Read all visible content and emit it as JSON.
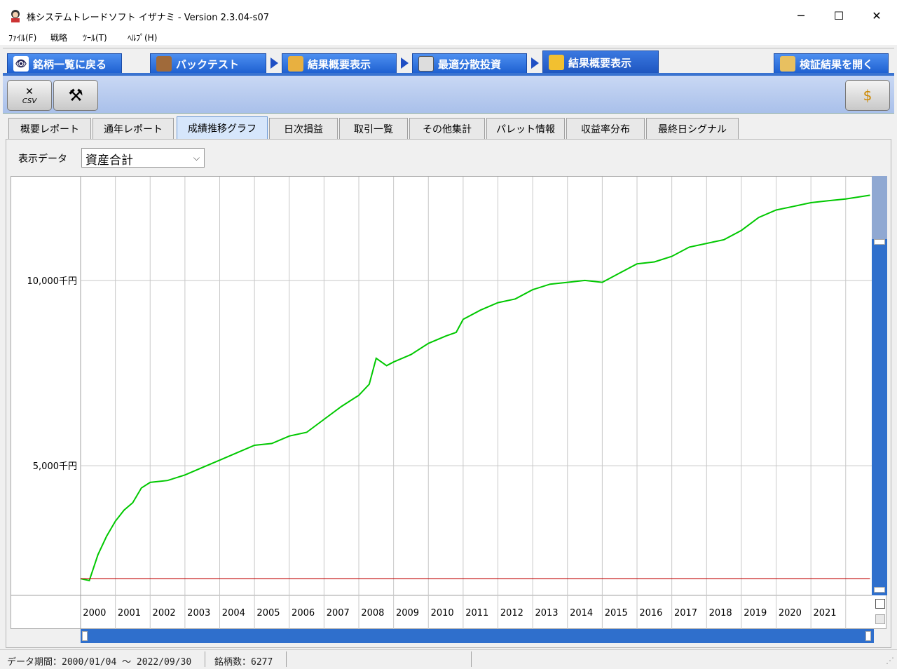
{
  "window": {
    "title": "株システムトレードソフト イザナミ - Version 2.3.04-s07",
    "minimize_glyph": "─",
    "maximize_glyph": "☐",
    "close_glyph": "✕"
  },
  "menu": [
    "ﾌｧｲﾙ(F)",
    "戦略",
    "ﾂｰﾙ(T)",
    "ﾍﾙﾌﾟ(H)"
  ],
  "nav_tabs": [
    {
      "label": "銘柄一覧に戻る",
      "icon": "eye-icon"
    },
    {
      "label": "バックテスト",
      "icon": "bag-icon"
    },
    {
      "label": "結果概要表示",
      "icon": "results-icon"
    },
    {
      "label": "最適分散投資",
      "icon": "calendar-icon"
    },
    {
      "label": "結果概要表示",
      "icon": "bar-chart-icon"
    },
    {
      "label": "検証結果を開く",
      "icon": "open-results-icon"
    }
  ],
  "toolbar": {
    "csv_label": "CSV"
  },
  "sub_tabs": [
    "概要レポート",
    "通年レポート",
    "成績推移グラフ",
    "日次損益",
    "取引一覧",
    "その他集計",
    "パレット情報",
    "収益率分布",
    "最終日シグナル"
  ],
  "active_sub_tab": "成績推移グラフ",
  "display_data": {
    "label": "表示データ",
    "selected": "資産合計"
  },
  "chart_data": {
    "type": "line",
    "title": "",
    "xlabel": "",
    "ylabel": "",
    "x_tick_labels": [
      "2000",
      "2001",
      "2002",
      "2003",
      "2004",
      "2005",
      "2006",
      "2007",
      "2008",
      "2009",
      "2010",
      "2011",
      "2012",
      "2013",
      "2014",
      "2015",
      "2016",
      "2017",
      "2018",
      "2019",
      "2020",
      "2021"
    ],
    "y_tick_labels": [
      "10,000千円",
      "5,000千円"
    ],
    "y_ticks": [
      10000,
      5000
    ],
    "ylim": [
      1500,
      12800
    ],
    "x": [
      2000.0,
      2000.25,
      2000.5,
      2000.75,
      2001.0,
      2001.25,
      2001.5,
      2001.75,
      2002.0,
      2002.5,
      2003.0,
      2003.5,
      2004.0,
      2004.5,
      2005.0,
      2005.5,
      2006.0,
      2006.5,
      2007.0,
      2007.5,
      2008.0,
      2008.3,
      2008.5,
      2008.8,
      2009.0,
      2009.5,
      2010.0,
      2010.5,
      2010.8,
      2011.0,
      2011.5,
      2012.0,
      2012.5,
      2013.0,
      2013.5,
      2014.0,
      2014.5,
      2015.0,
      2015.5,
      2016.0,
      2016.5,
      2017.0,
      2017.5,
      2018.0,
      2018.5,
      2019.0,
      2019.5,
      2020.0,
      2020.5,
      2021.0,
      2021.5,
      2022.0,
      2022.7
    ],
    "series": [
      {
        "color": "#00c800",
        "values": [
          1950,
          1900,
          2600,
          3100,
          3500,
          3800,
          4000,
          4400,
          4550,
          4600,
          4750,
          4950,
          5150,
          5350,
          5550,
          5600,
          5800,
          5900,
          6250,
          6600,
          6900,
          7200,
          7900,
          7700,
          7800,
          8000,
          8300,
          8500,
          8600,
          8950,
          9200,
          9400,
          9500,
          9750,
          9900,
          9950,
          10000,
          9950,
          10200,
          10450,
          10500,
          10650,
          10900,
          11000,
          11100,
          11350,
          11700,
          11900,
          12000,
          12100,
          12150,
          12200,
          12300
        ]
      },
      {
        "color": "#c00000",
        "values": [
          1950,
          1950,
          1950,
          1950,
          1950,
          1950,
          1950,
          1950,
          1950,
          1950,
          1950,
          1950,
          1950,
          1950,
          1950,
          1950,
          1950,
          1950,
          1950,
          1950,
          1950,
          1950,
          1950,
          1950,
          1950,
          1950,
          1950,
          1950,
          1950,
          1950,
          1950,
          1950,
          1950,
          1950,
          1950,
          1950,
          1950,
          1950,
          1950,
          1950,
          1950,
          1950,
          1950,
          1950,
          1950,
          1950,
          1950,
          1950,
          1950,
          1950,
          1950,
          1950,
          1950
        ]
      }
    ],
    "grid": true
  },
  "status": {
    "period_label": "データ期間：2000/01/04 ～ 2022/09/30",
    "count_label": "銘柄数：6277"
  }
}
